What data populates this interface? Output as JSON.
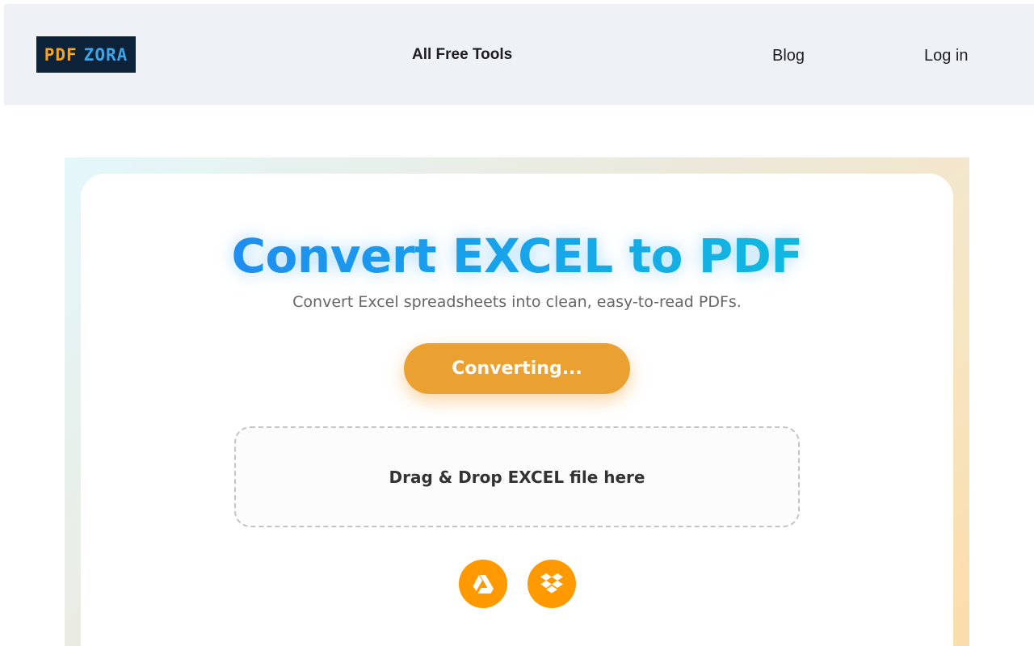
{
  "header": {
    "logo": {
      "part1": "PDF",
      "part2": "ZORA"
    },
    "nav": {
      "all_tools": "All Free Tools",
      "blog": "Blog",
      "login": "Log in"
    }
  },
  "main": {
    "title": "Convert EXCEL to PDF",
    "subtitle": "Convert Excel spreadsheets into clean, easy-to-read PDFs.",
    "convert_button_label": "Converting...",
    "drop_zone_text": "Drag & Drop EXCEL file here",
    "sources": [
      {
        "icon": "google-drive-icon"
      },
      {
        "icon": "dropbox-icon"
      }
    ]
  },
  "colors": {
    "header_bg": "#eef1f6",
    "title_gradient_start": "#1e8ef0",
    "title_gradient_end": "#10b9df",
    "button_orange": "#eba132",
    "source_icon_bg": "#ff9900",
    "logo_bg": "#0b2238"
  }
}
